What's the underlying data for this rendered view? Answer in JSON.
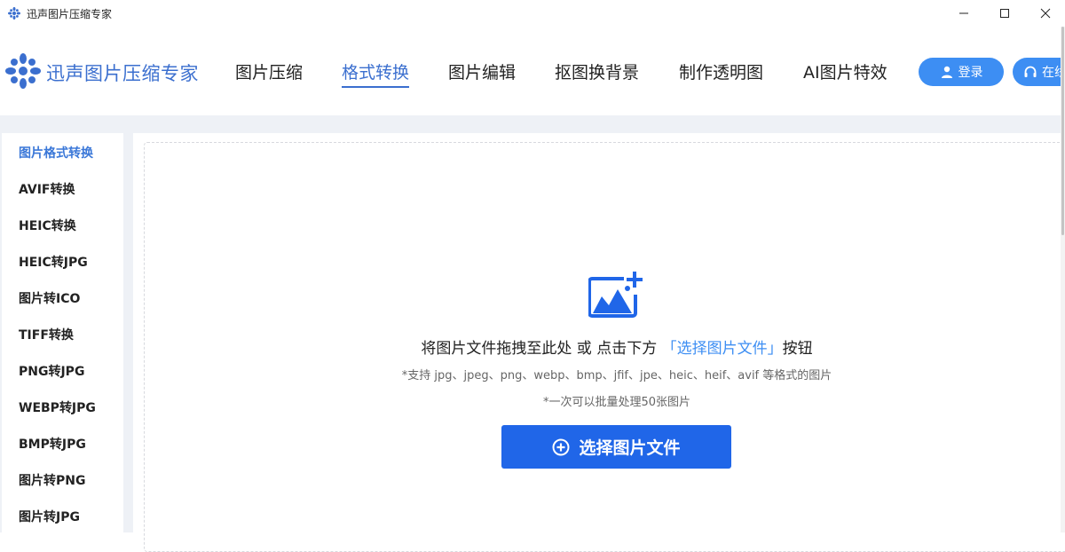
{
  "window": {
    "title": "迅声图片压缩专家",
    "controls": {
      "minimize_icon": "minimize-icon",
      "maximize_icon": "maximize-icon",
      "close_icon": "close-icon"
    }
  },
  "header": {
    "logo_text": "迅声图片压缩专家",
    "nav": [
      {
        "label": "图片压缩",
        "active": false
      },
      {
        "label": "格式转换",
        "active": true
      },
      {
        "label": "图片编辑",
        "active": false
      },
      {
        "label": "抠图换背景",
        "active": false
      },
      {
        "label": "制作透明图",
        "active": false
      },
      {
        "label": "AI图片特效",
        "active": false
      }
    ],
    "login_label": "登录",
    "online_label": "在线"
  },
  "sidebar": {
    "items": [
      {
        "label": "图片格式转换",
        "active": true
      },
      {
        "label": "AVIF转换"
      },
      {
        "label": "HEIC转换"
      },
      {
        "label": "HEIC转JPG"
      },
      {
        "label": "图片转ICO"
      },
      {
        "label": "TIFF转换"
      },
      {
        "label": "PNG转JPG"
      },
      {
        "label": "WEBP转JPG"
      },
      {
        "label": "BMP转JPG"
      },
      {
        "label": "图片转PNG"
      },
      {
        "label": "图片转JPG"
      }
    ]
  },
  "main": {
    "drop_text_prefix": "将图片文件拖拽至此处 或 点击下方",
    "drop_text_link": "「选择图片文件」",
    "drop_text_suffix": "按钮",
    "formats_hint": "*支持 jpg、jpeg、png、webp、bmp、jfif、jpe、heic、heif、avif 等格式的图片",
    "batch_hint": "*一次可以批量处理50张图片",
    "select_button_label": "选择图片文件"
  },
  "colors": {
    "accent": "#3b6fcf",
    "button_blue": "#2066e8",
    "pill_blue": "#3d8ef3",
    "band_gray": "#eef1f6"
  }
}
